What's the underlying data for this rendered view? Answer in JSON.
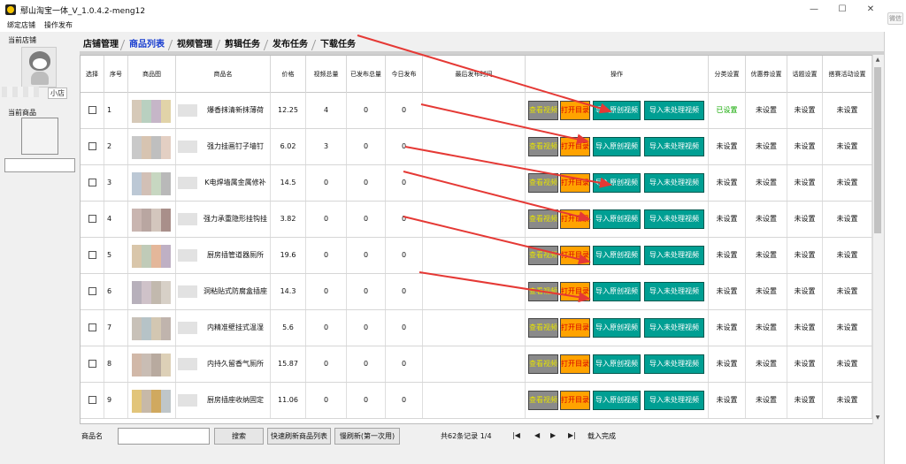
{
  "window": {
    "title": "鄢山淘宝一体_V_1.0.4.2-meng12",
    "minimize_icon": "minimize-icon",
    "maximize_icon": "maximize-icon",
    "close_icon": "close-icon"
  },
  "outside": {
    "fragment": "微信"
  },
  "menu": [
    "绑定店铺",
    "操作发布"
  ],
  "left_panel": {
    "current_store_label": "当前店铺",
    "store_name": "小店",
    "current_product_label": "当前商品"
  },
  "tabs": [
    "店铺管理",
    "商品列表",
    "视频管理",
    "剪辑任务",
    "发布任务",
    "下载任务"
  ],
  "active_tab": "商品列表",
  "table": {
    "headers": [
      "选择",
      "序号",
      "商品图",
      "商品名",
      "价格",
      "视频总量",
      "已发布总量",
      "今日发布",
      "最后发布时间",
      "操作",
      "分类设置",
      "优惠券设置",
      "话题设置",
      "搭赛活动设置"
    ],
    "button_labels": {
      "view": "查看视频",
      "open": "打开目录",
      "import_original": "导入原创视频",
      "import_unprocessed": "导入未处理视频"
    },
    "rows": [
      {
        "index": "1",
        "name": "爆香抹清新抹薄荷",
        "price": "12.25",
        "video_total": "4",
        "published_total": "0",
        "today": "0",
        "last_time": "",
        "category": "已设置",
        "coupon": "未设置",
        "topic": "未设置",
        "activity": "未设置"
      },
      {
        "index": "2",
        "name": "强力挂画钉子墙钉",
        "price": "6.02",
        "video_total": "3",
        "published_total": "0",
        "today": "0",
        "last_time": "",
        "category": "未设置",
        "coupon": "未设置",
        "topic": "未设置",
        "activity": "未设置"
      },
      {
        "index": "3",
        "name": "K电焊墙属金属修补",
        "price": "14.5",
        "video_total": "0",
        "published_total": "0",
        "today": "0",
        "last_time": "",
        "category": "未设置",
        "coupon": "未设置",
        "topic": "未设置",
        "activity": "未设置"
      },
      {
        "index": "4",
        "name": "强力承重隐形挂钩挂",
        "price": "3.82",
        "video_total": "0",
        "published_total": "0",
        "today": "0",
        "last_time": "",
        "category": "未设置",
        "coupon": "未设置",
        "topic": "未设置",
        "activity": "未设置"
      },
      {
        "index": "5",
        "name": "厨房插管道器厕所",
        "price": "19.6",
        "video_total": "0",
        "published_total": "0",
        "today": "0",
        "last_time": "",
        "category": "未设置",
        "coupon": "未设置",
        "topic": "未设置",
        "activity": "未设置"
      },
      {
        "index": "6",
        "name": "洞粘贴式防腐盒插座",
        "price": "14.3",
        "video_total": "0",
        "published_total": "0",
        "today": "0",
        "last_time": "",
        "category": "未设置",
        "coupon": "未设置",
        "topic": "未设置",
        "activity": "未设置"
      },
      {
        "index": "7",
        "name": "内精准壁挂式温湿",
        "price": "5.6",
        "video_total": "0",
        "published_total": "0",
        "today": "0",
        "last_time": "",
        "category": "未设置",
        "coupon": "未设置",
        "topic": "未设置",
        "activity": "未设置"
      },
      {
        "index": "8",
        "name": "内持久留香气厕所",
        "price": "15.87",
        "video_total": "0",
        "published_total": "0",
        "today": "0",
        "last_time": "",
        "category": "未设置",
        "coupon": "未设置",
        "topic": "未设置",
        "activity": "未设置"
      },
      {
        "index": "9",
        "name": "厨房插座收纳固定",
        "price": "11.06",
        "video_total": "0",
        "published_total": "0",
        "today": "0",
        "last_time": "",
        "category": "未设置",
        "coupon": "未设置",
        "topic": "未设置",
        "activity": "未设置"
      }
    ]
  },
  "bottom": {
    "product_name_label": "商品名",
    "product_name_value": "",
    "search_button": "搜索",
    "quick_refresh_button": "快速刷新商品列表",
    "slow_refresh_button": "慢刷新(第一次用)",
    "record_info": "共62条记录 1/4",
    "first_icon": "first-page-icon",
    "prev_icon": "prev-page-icon",
    "next_icon": "next-page-icon",
    "last_icon": "last-page-icon",
    "status": "载入完成"
  },
  "colors": {
    "btn_view_bg": "#8a8a8a",
    "btn_open_bg": "#ffa300",
    "btn_teal_bg": "#009f93",
    "set_green": "#11a800",
    "arrow_red": "#e53935",
    "active_tab": "#1a3fd0"
  }
}
